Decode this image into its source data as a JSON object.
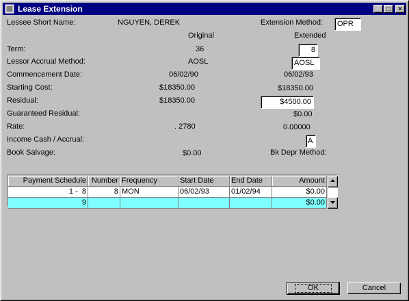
{
  "window": {
    "title": "Lease Extension"
  },
  "titlebar_buttons": {
    "minimize": "_",
    "maximize": "□",
    "close": "×"
  },
  "lessee": {
    "label": "Lessee Short Name:",
    "value": "NGUYEN, DEREK"
  },
  "extension_method": {
    "label": "Extension Method:",
    "value": "OPR"
  },
  "columns": {
    "original": "Original",
    "extended": "Extended"
  },
  "fields": {
    "term": {
      "label": "Term:",
      "original": "36",
      "extended": "8"
    },
    "accrual_method": {
      "label": "Lessor Accrual Method:",
      "original": "AOSL",
      "extended": "AOSL"
    },
    "commencement": {
      "label": "Commencement Date:",
      "original": "06/02/90",
      "extended": "06/02/93"
    },
    "starting_cost": {
      "label": "Starting Cost:",
      "original": "$18350.00",
      "extended": "$18350.00"
    },
    "residual": {
      "label": "Residual:",
      "original": "$18350.00",
      "extended": "$4500.00"
    },
    "guaranteed_residual": {
      "label": "Guaranteed Residual:",
      "extended": "$0.00"
    },
    "rate": {
      "label": " Rate:",
      "original": ". 2780",
      "extended": "0.00000"
    },
    "income": {
      "label": "Income Cash / Accrual:",
      "extended": "A"
    },
    "book_salvage": {
      "label": "Book Salvage:",
      "original": "$0.00"
    },
    "bk_depr": {
      "label": "Bk Depr Method:"
    }
  },
  "schedule": {
    "headers": [
      "Payment Schedule",
      "Number",
      "Frequency",
      "Start Date",
      "End Date",
      "Amount"
    ],
    "rows": [
      [
        "1 -  8",
        "8",
        "MON",
        "06/02/93",
        "01/02/94",
        "$0.00"
      ],
      [
        "9",
        "",
        "",
        "",
        "",
        "$0.00"
      ]
    ]
  },
  "buttons": {
    "ok": "OK",
    "cancel": "Cancel"
  }
}
